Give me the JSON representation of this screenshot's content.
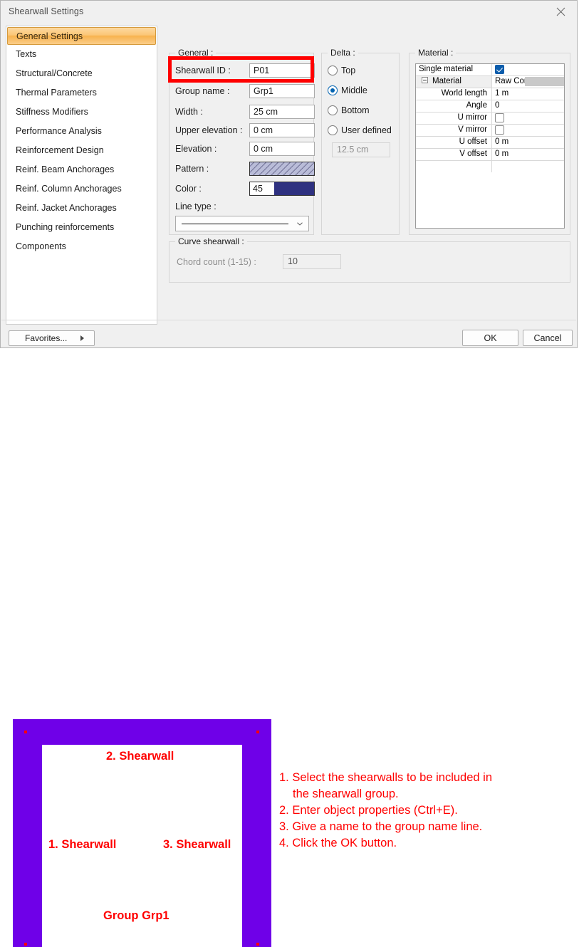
{
  "window": {
    "title": "Shearwall Settings",
    "close_icon": "close-icon"
  },
  "sidebar": {
    "items": [
      {
        "label": "General Settings",
        "selected": true
      },
      {
        "label": "Texts",
        "selected": false
      },
      {
        "label": "Structural/Concrete",
        "selected": false
      },
      {
        "label": "Thermal Parameters",
        "selected": false
      },
      {
        "label": "Stiffness Modifiers",
        "selected": false
      },
      {
        "label": "Performance Analysis",
        "selected": false
      },
      {
        "label": "Reinforcement Design",
        "selected": false
      },
      {
        "label": "Reinf. Beam Anchorages",
        "selected": false
      },
      {
        "label": "Reinf. Column Anchorages",
        "selected": false
      },
      {
        "label": "Reinf. Jacket Anchorages",
        "selected": false
      },
      {
        "label": "Punching reinforcements",
        "selected": false
      },
      {
        "label": "Components",
        "selected": false
      }
    ],
    "favorites_label": "Favorites...",
    "favorites_arrow": "chevron-right-icon"
  },
  "general": {
    "title": "General :",
    "shearwall_id_label": "Shearwall ID :",
    "shearwall_id_value": "P01",
    "group_name_label": "Group name :",
    "group_name_value": "Grp1",
    "width_label": "Width :",
    "width_value": "25 cm",
    "upper_elevation_label": "Upper elevation :",
    "upper_elevation_value": "0 cm",
    "elevation_label": "Elevation :",
    "elevation_value": "0 cm",
    "pattern_label": "Pattern :",
    "color_label": "Color :",
    "color_value": "45",
    "color_swatch_hex": "#2e3180",
    "line_type_label": "Line type :"
  },
  "delta": {
    "title": "Delta :",
    "options": [
      {
        "label": "Top",
        "checked": false
      },
      {
        "label": "Middle",
        "checked": true
      },
      {
        "label": "Bottom",
        "checked": false
      },
      {
        "label": "User defined",
        "checked": false
      }
    ],
    "user_value": "12.5 cm"
  },
  "material": {
    "title": "Material :",
    "rows": [
      {
        "key": "Single material",
        "value": "",
        "checkbox": "checked",
        "indent": false,
        "expander": false,
        "swatch": false
      },
      {
        "key": "Material",
        "value": "Raw Conc",
        "checkbox": "none",
        "indent": false,
        "expander": true,
        "swatch": true
      },
      {
        "key": "World length",
        "value": "1 m",
        "checkbox": "none",
        "indent": true,
        "expander": false,
        "swatch": false
      },
      {
        "key": "Angle",
        "value": "0",
        "checkbox": "none",
        "indent": true,
        "expander": false,
        "swatch": false
      },
      {
        "key": "U mirror",
        "value": "",
        "checkbox": "unchecked",
        "indent": true,
        "expander": false,
        "swatch": false
      },
      {
        "key": "V mirror",
        "value": "",
        "checkbox": "unchecked",
        "indent": true,
        "expander": false,
        "swatch": false
      },
      {
        "key": "U offset",
        "value": "0 m",
        "checkbox": "none",
        "indent": true,
        "expander": false,
        "swatch": false
      },
      {
        "key": "V offset",
        "value": "0 m",
        "checkbox": "none",
        "indent": true,
        "expander": false,
        "swatch": false
      }
    ]
  },
  "curve": {
    "title": "Curve shearwall :",
    "chord_label": "Chord count (1-15) :",
    "chord_value": "10"
  },
  "footer": {
    "ok_label": "OK",
    "cancel_label": "Cancel"
  },
  "illustration": {
    "accent_hex": "#6f00e8",
    "annotation_hex": "#ff0000",
    "labels": [
      {
        "text": "2. Shearwall"
      },
      {
        "text": "1. Shearwall"
      },
      {
        "text": "3. Shearwall"
      },
      {
        "text": "Group Grp1"
      }
    ],
    "steps": [
      "1. Select the shearwalls to be included in",
      "the shearwall group.",
      "2. Enter object properties (Ctrl+E).",
      "3. Give a name to the group name line.",
      "4. Click the OK button."
    ]
  },
  "highlight": {
    "color_hex": "#ff0000",
    "target": "group-name-row"
  }
}
